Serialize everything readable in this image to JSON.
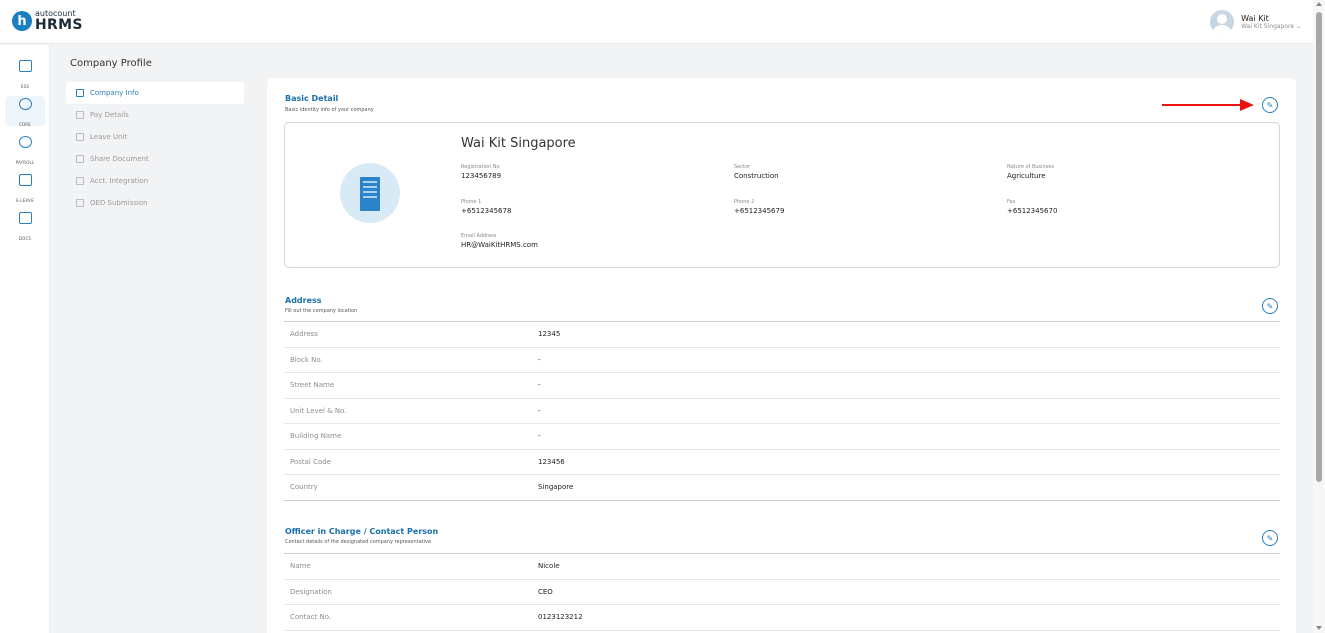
{
  "brand": {
    "auto": "autocount",
    "hrms": "HRMS",
    "badge": "h"
  },
  "user": {
    "name": "Wai Kit",
    "company": "Wai Kit Singapore ⌄"
  },
  "rail": [
    {
      "label": "ESS",
      "icon": "ess-icon"
    },
    {
      "label": "CORE",
      "icon": "core-icon"
    },
    {
      "label": "PAYROLL",
      "icon": "payroll-icon"
    },
    {
      "label": "E-LEAVE",
      "icon": "calendar-icon"
    },
    {
      "label": "DOCS",
      "icon": "docs-icon"
    }
  ],
  "subnav": {
    "title": "Company Profile",
    "items": [
      {
        "label": "Company Info",
        "active": true
      },
      {
        "label": "Pay Details"
      },
      {
        "label": "Leave Unit"
      },
      {
        "label": "Share Document"
      },
      {
        "label": "Acct. Integration"
      },
      {
        "label": "OED Submission"
      }
    ]
  },
  "basic": {
    "title": "Basic Detail",
    "subtitle": "Basic identity info of your company",
    "company_name": "Wai Kit Singapore",
    "fields": {
      "reg_no": {
        "label": "Registration No",
        "value": "123456789"
      },
      "sector": {
        "label": "Sector",
        "value": "Construction"
      },
      "nature": {
        "label": "Nature of Business",
        "value": "Agriculture"
      },
      "phone1": {
        "label": "Phone 1",
        "value": "+6512345678"
      },
      "phone2": {
        "label": "Phone 2",
        "value": "+6512345679"
      },
      "fax": {
        "label": "Fax",
        "value": "+6512345670"
      },
      "email": {
        "label": "Email Address",
        "value": "HR@WaiKitHRMS.com"
      }
    }
  },
  "address": {
    "title": "Address",
    "subtitle": "Fill out the company location",
    "rows": [
      {
        "k": "Address",
        "v": "12345"
      },
      {
        "k": "Block No.",
        "v": "-"
      },
      {
        "k": "Street Name",
        "v": "-"
      },
      {
        "k": "Unit Level & No.",
        "v": "-"
      },
      {
        "k": "Building Name",
        "v": "-"
      },
      {
        "k": "Postal Code",
        "v": "123456"
      },
      {
        "k": "Country",
        "v": "Singapore"
      }
    ]
  },
  "officer": {
    "title": "Officer in Charge / Contact Person",
    "subtitle": "Contact details of the designated company representative",
    "rows": [
      {
        "k": "Name",
        "v": "Nicole"
      },
      {
        "k": "Designation",
        "v": "CEO"
      },
      {
        "k": "Contact No.",
        "v": "0123123212"
      }
    ]
  },
  "icons": {
    "edit": "✎"
  },
  "colors": {
    "accent": "#2c7fb8",
    "annotation_arrow": "#e11111"
  }
}
